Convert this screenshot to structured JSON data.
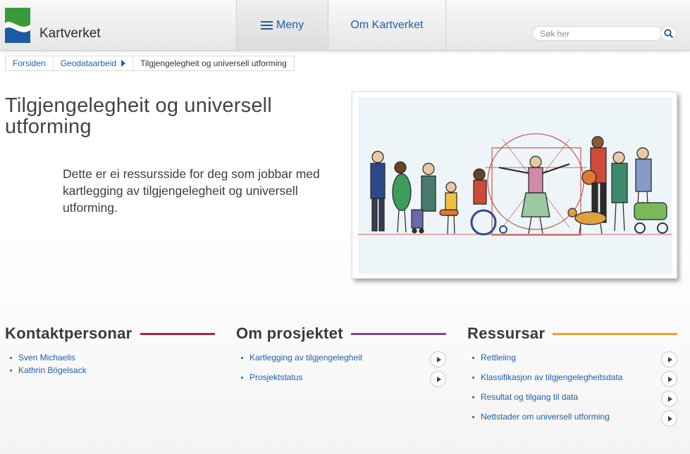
{
  "header": {
    "logo_text": "Kartverket",
    "nav": {
      "menu_label": "Meny",
      "about_label": "Om Kartverket"
    },
    "search": {
      "placeholder": "Søk her",
      "value": ""
    }
  },
  "breadcrumb": [
    "Forsiden",
    "Geodataarbeid",
    "Tilgjengelegheit og universell utforming"
  ],
  "page": {
    "title": "Tilgjengelegheit og universell utforming",
    "intro": "Dette er ei ressursside for deg som jobbar med kartlegging av tilgjengelegheit og universell utforming."
  },
  "sections": {
    "kontakt": {
      "title": "Kontaktpersonar",
      "accent": "#a3284b",
      "items": [
        "Sven Michaelis",
        "Kathrin Bögelsack"
      ]
    },
    "prosjekt": {
      "title": "Om prosjektet",
      "accent": "#7b4a9c",
      "items": [
        "Kartlegging av tilgjengelegheit",
        "Prosjektstatus"
      ]
    },
    "ressursar": {
      "title": "Ressursar",
      "accent": "#f0a21e",
      "items": [
        "Rettleiing",
        "Klassifikasjon av tilgjengelegheitsdata",
        "Resultat og tilgang til data",
        "Nettstader om universell utforming"
      ]
    }
  },
  "icons": {
    "logo": "kartverket-logo-icon",
    "menu": "hamburger-icon",
    "search": "search-icon",
    "arrow": "arrow-right-icon"
  },
  "colors": {
    "link": "#1f5ea8",
    "logo_green": "#3a9a3a",
    "logo_blue": "#1c5aa6"
  }
}
